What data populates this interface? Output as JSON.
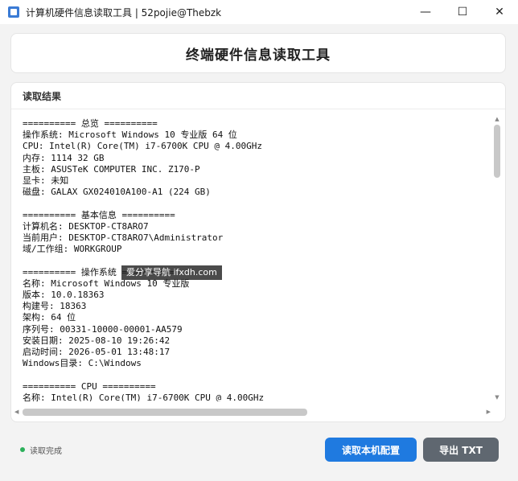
{
  "window": {
    "title": "计算机硬件信息读取工具 | 52pojie@Thebzk",
    "controls": {
      "minimize": "—",
      "maximize": "☐",
      "close": "✕"
    }
  },
  "header": {
    "title": "终端硬件信息读取工具"
  },
  "result": {
    "label": "读取结果",
    "lines": [
      "========== 总览 ==========",
      "操作系统: Microsoft Windows 10 专业版 64 位",
      "CPU: Intel(R) Core(TM) i7-6700K CPU @ 4.00GHz",
      "内存: 1114 32 GB",
      "主板: ASUSTeK COMPUTER INC. Z170-P",
      "显卡: 未知",
      "磁盘: GALAX GX024010A100-A1 (224 GB)",
      "",
      "========== 基本信息 ==========",
      "计算机名: DESKTOP-CT8ARO7",
      "当前用户: DESKTOP-CT8ARO7\\Administrator",
      "域/工作组: WORKGROUP",
      "",
      "========== 操作系统 ==========",
      "名称: Microsoft Windows 10 专业版",
      "版本: 10.0.18363",
      "构建号: 18363",
      "架构: 64 位",
      "序列号: 00331-10000-00001-AA579",
      "安装日期: 2025-08-10 19:26:42",
      "启动时间: 2026-05-01 13:48:17",
      "Windows目录: C:\\Windows",
      "",
      "========== CPU ==========",
      "名称: Intel(R) Core(TM) i7-6700K CPU @ 4.00GHz"
    ]
  },
  "watermark": "爱分享导航 ifxdh.com",
  "status": {
    "text": "读取完成",
    "dot_color": "#2bb05a"
  },
  "buttons": {
    "read": "读取本机配置",
    "export": "导出 TXT"
  },
  "colors": {
    "primary": "#1f7ae0",
    "secondary": "#5f6770"
  }
}
